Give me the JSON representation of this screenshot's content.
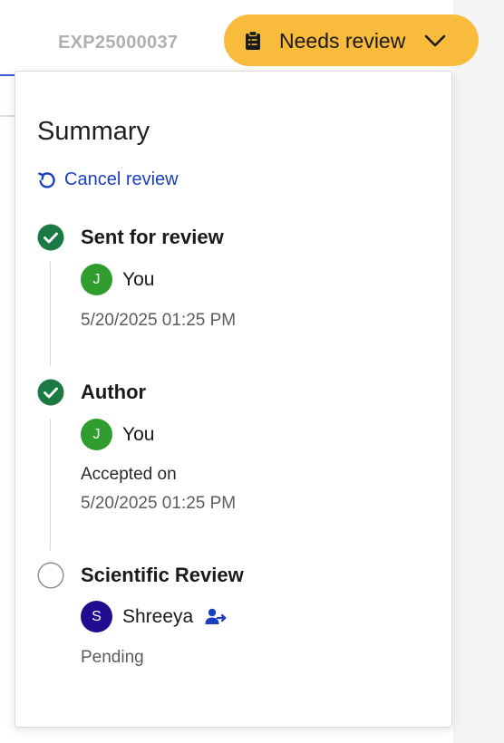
{
  "header": {
    "experiment_id": "EXP25000037",
    "status_label": "Needs review",
    "status_color": "#f8bb3c"
  },
  "panel": {
    "title": "Summary",
    "cancel_label": "Cancel review",
    "steps": [
      {
        "title": "Sent for review",
        "state": "done",
        "user_initial": "J",
        "user_name": "You",
        "timestamp": "5/20/2025 01:25 PM"
      },
      {
        "title": "Author",
        "state": "done",
        "user_initial": "J",
        "user_name": "You",
        "note": "Accepted on",
        "timestamp": "5/20/2025 01:25 PM"
      },
      {
        "title": "Scientific Review",
        "state": "pending",
        "user_initial": "S",
        "user_name": "Shreeya",
        "status": "Pending"
      }
    ]
  },
  "icons": {
    "status": "clipboard-icon",
    "dropdown": "chevron-down-icon",
    "cancel": "undo-icon",
    "done": "check-circle-icon",
    "pending": "empty-circle-icon",
    "reassign": "reassign-user-icon"
  },
  "colors": {
    "accent_blue": "#1a3fbf",
    "done_green": "#1b7a43",
    "avatar_green": "#2e9d2e",
    "avatar_navy": "#1f0c8f"
  }
}
